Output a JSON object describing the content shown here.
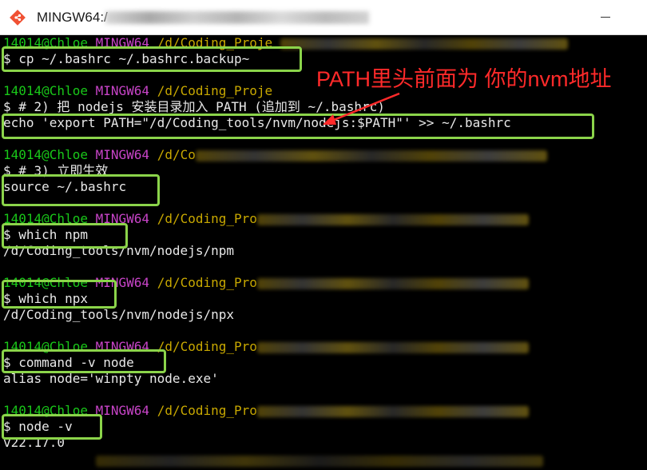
{
  "window": {
    "title": "MINGW64:/",
    "app_icon": "git-bash-icon"
  },
  "prompt": {
    "user_host": "14014@Chloe",
    "shell": "MINGW64",
    "paths": [
      "/d/Coding_Proje",
      "/d/Coding_Proje",
      "/d/Co",
      "/d/Coding_Pro",
      "/d/Coding_Pro",
      "/d/Coding_Pro",
      "/d/Coding_Pro"
    ]
  },
  "lines": {
    "cmd_backup": "$ cp ~/.bashrc ~/.bashrc.backup~",
    "comment_2": "$ # 2) 把 nodejs 安装目录加入 PATH (追加到 ~/.bashrc)",
    "cmd_echo": "echo 'export PATH=\"/d/Coding_tools/nvm/nodejs:$PATH\"' >> ~/.bashrc",
    "comment_3": "$ # 3) 立即生效",
    "cmd_source": "source ~/.bashrc",
    "cmd_which_npm": "$ which npm",
    "out_npm": "/d/Coding_tools/nvm/nodejs/npm",
    "cmd_which_npx": "$ which npx",
    "out_npx": "/d/Coding_tools/nvm/nodejs/npx",
    "cmd_command_v": "$ command -v node",
    "out_alias": "alias node='winpty node.exe'",
    "cmd_node_v": "$ node -v",
    "out_version": "v22.17.0"
  },
  "annotation": {
    "text": "PATH里头前面为 你的nvm地址",
    "color": "#ff2a2a"
  },
  "colors": {
    "highlight_box": "#8bd44a",
    "prompt_user": "#19c819",
    "prompt_shell": "#c844c8",
    "prompt_path": "#c8a800",
    "terminal_bg": "#000000",
    "terminal_text": "#e8e8e8"
  }
}
